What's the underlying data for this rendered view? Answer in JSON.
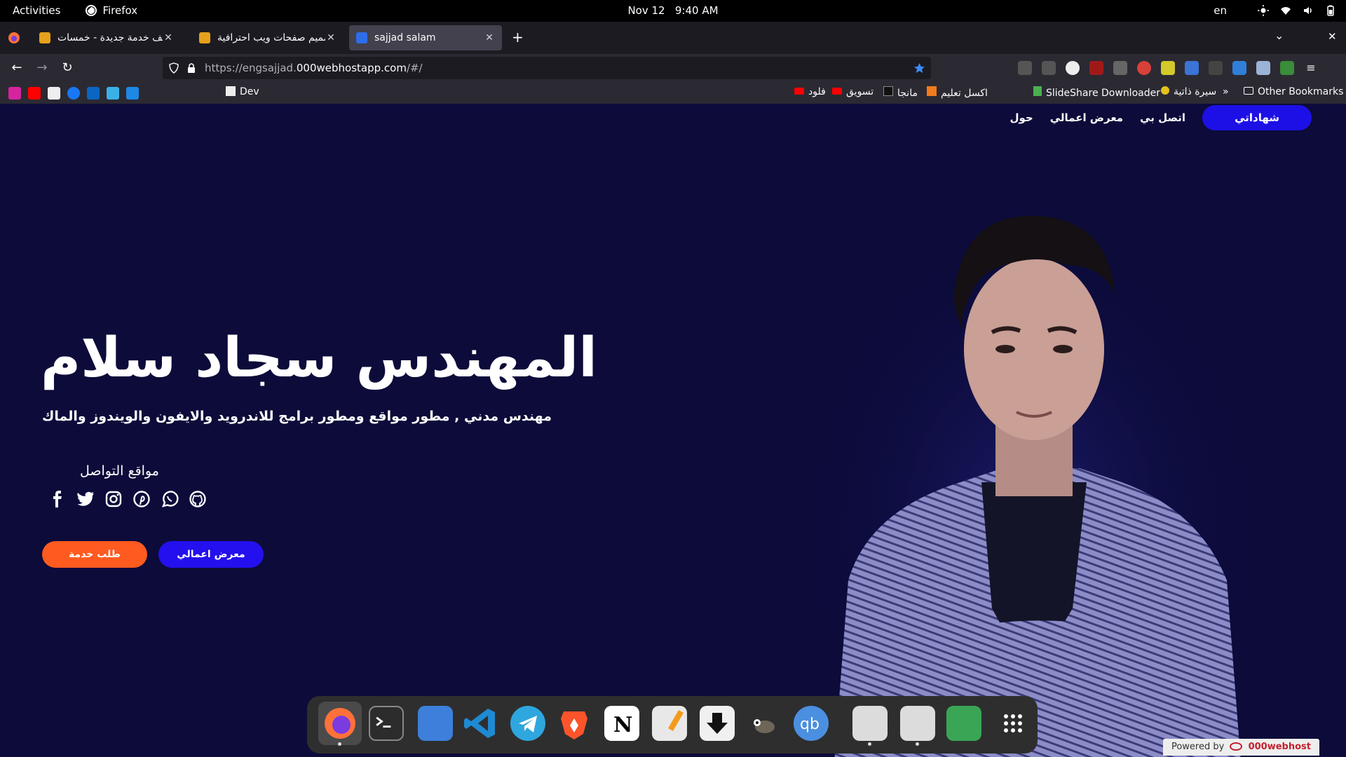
{
  "system": {
    "activities": "Activities",
    "app_name": "Firefox",
    "date": "Nov 12",
    "time": "9:40 AM",
    "lang": "en"
  },
  "tabs": [
    {
      "title": "أضف خدمة جديدة - خمسات",
      "favicon_color": "#e5a11b",
      "favicon_text": "5"
    },
    {
      "title": "تصميم صفحات ويب احترافية",
      "favicon_color": "#e5a11b",
      "favicon_text": "5"
    },
    {
      "title": "sajjad salam",
      "favicon_color": "#2d6de8",
      "favicon_text": ""
    }
  ],
  "url": {
    "prefix": "https://engsajjad.",
    "domain": "000webhostapp.com",
    "suffix": "/#/"
  },
  "bookmarks": {
    "dev": "Dev",
    "tasweeq": "تسويق",
    "floud": "فلود",
    "manga": "مانجا",
    "aksel": "اكسل تعليم",
    "slideshare": "SlideShare Downloader",
    "cv": "سيرة ذاتية",
    "other": "Other Bookmarks"
  },
  "site": {
    "nav": {
      "certificates": "شهاداتي",
      "contact": "اتصل بي",
      "portfolio": "معرض اعمالي",
      "about": "حول"
    },
    "hero_name": "المهندس سجاد سلام",
    "hero_sub": "مهندس مدني , مطور مواقع  ومطور برامج للاندرويد والايفون والويندوز والماك",
    "social_title": "مواقع التواصل",
    "socials": [
      "facebook-icon",
      "twitter-icon",
      "instagram-icon",
      "pinterest-icon",
      "whatsapp-icon",
      "github-icon"
    ],
    "btn_service": "طلب خدمة",
    "btn_portfolio": "معرض اعمالي",
    "powered_by": "Powered by",
    "powered_brand": "000webhost"
  },
  "colors": {
    "page_bg": "#0c0b3a",
    "accent_blue": "#2410ee",
    "accent_orange": "#ff5a1f"
  }
}
